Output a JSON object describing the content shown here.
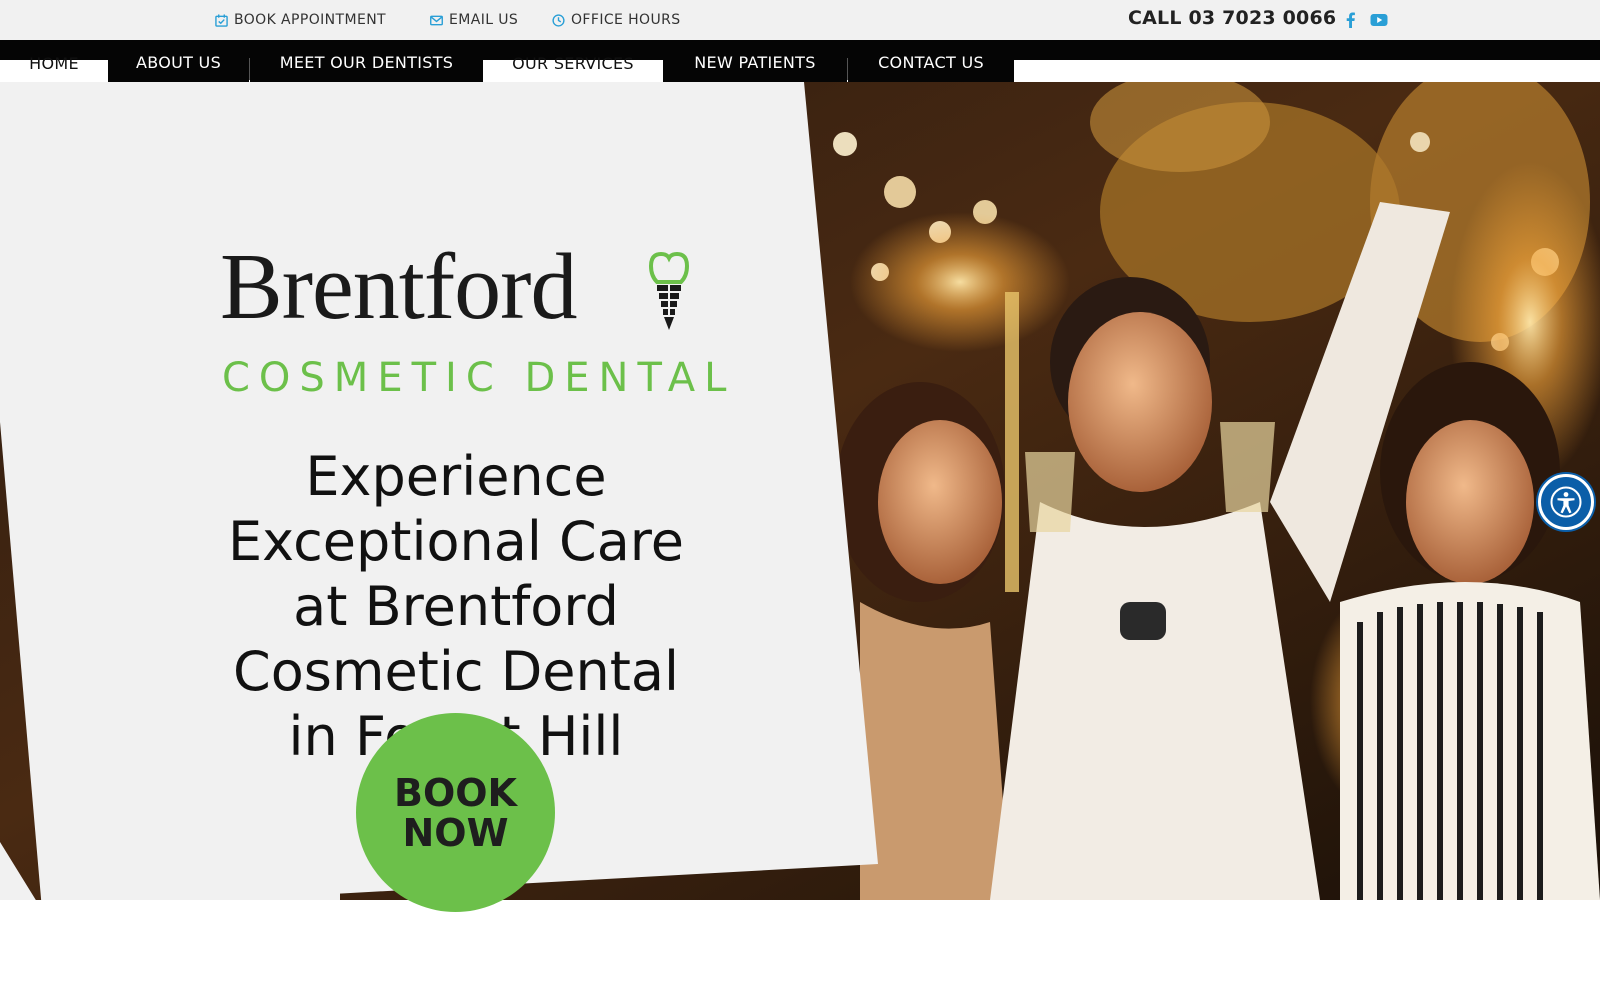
{
  "topbar": {
    "book_appointment": "BOOK APPOINTMENT",
    "email_us": "EMAIL US",
    "office_hours": "OFFICE HOURS",
    "phone": "CALL 03 7023 0066",
    "icon_color": "#2a9fd6",
    "social": [
      "facebook-icon",
      "youtube-icon"
    ]
  },
  "nav": {
    "items": [
      "HOME",
      "ABOUT US",
      "MEET OUR DENTISTS",
      "OUR SERVICES",
      "NEW PATIENTS",
      "CONTACT US"
    ]
  },
  "hero": {
    "brand_name": "Brentford",
    "brand_sub": "COSMETIC DENTAL",
    "headline_lines": [
      "Experience",
      "Exceptional Care",
      "at Brentford",
      "Cosmetic Dental",
      "in Forest Hill"
    ],
    "book_line1": "BOOK",
    "book_line2": "NOW",
    "accent_color": "#6cc04a"
  },
  "accessibility": {
    "icon": "accessibility-icon"
  }
}
